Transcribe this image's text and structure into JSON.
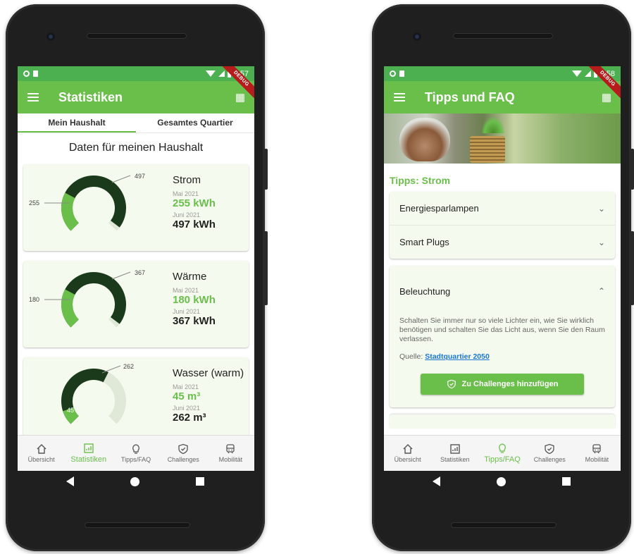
{
  "left": {
    "status_time": "5:57",
    "debug_label": "DEBUG",
    "appbar_title": "Statistiken",
    "tabs": [
      {
        "label": "Mein Haushalt",
        "active": true
      },
      {
        "label": "Gesamtes Quartier",
        "active": false
      }
    ],
    "section_title": "Daten für meinen Haushalt",
    "cards": [
      {
        "name": "Strom",
        "month1": "Mai 2021",
        "value1": "255 kWh",
        "month2": "Juni 2021",
        "value2": "497 kWh",
        "gauge_value1": "255",
        "gauge_value2": "497",
        "fraction1": 0.27,
        "fraction2": 0.97
      },
      {
        "name": "Wärme",
        "month1": "Mai 2021",
        "value1": "180 kWh",
        "month2": "Juni 2021",
        "value2": "367 kWh",
        "gauge_value1": "180",
        "gauge_value2": "367",
        "fraction1": 0.27,
        "fraction2": 0.97
      },
      {
        "name": "Wasser (warm)",
        "month1": "Mai 2021",
        "value1": "45 m³",
        "month2": "Juni 2021",
        "value2": "262 m³",
        "gauge_value1": "45",
        "gauge_value2": "262",
        "fraction1": 0.1,
        "fraction2": 0.6
      }
    ]
  },
  "right": {
    "status_time": "5:58",
    "debug_label": "DEBUG",
    "appbar_title": "Tipps und FAQ",
    "tipps_heading": "Tipps: Strom",
    "collapsed_items": [
      {
        "label": "Energiesparlampen"
      },
      {
        "label": "Smart Plugs"
      }
    ],
    "expanded_item": {
      "label": "Beleuchtung",
      "body": "Schalten Sie immer nur so viele Lichter ein, wie Sie wirklich benötigen und schalten Sie das Licht aus, wenn Sie den Raum verlassen.",
      "source_label": "Quelle:",
      "source_link": "Stadtquartier 2050",
      "button_label": "Zu Challenges hinzufügen"
    }
  },
  "nav": {
    "items": [
      {
        "label": "Übersicht",
        "icon": "home-icon"
      },
      {
        "label": "Statistiken",
        "icon": "chart-icon"
      },
      {
        "label": "Tipps/FAQ",
        "icon": "lightbulb-icon"
      },
      {
        "label": "Challenges",
        "icon": "shield-check-icon"
      },
      {
        "label": "Mobilität",
        "icon": "train-icon"
      }
    ]
  },
  "colors": {
    "accent": "#6abf4b",
    "status_bar": "#4caf50",
    "gauge_dark": "#1b3a1b",
    "gauge_light": "#6abf4b",
    "card_bg": "#f4fbee",
    "link": "#1976d2"
  }
}
